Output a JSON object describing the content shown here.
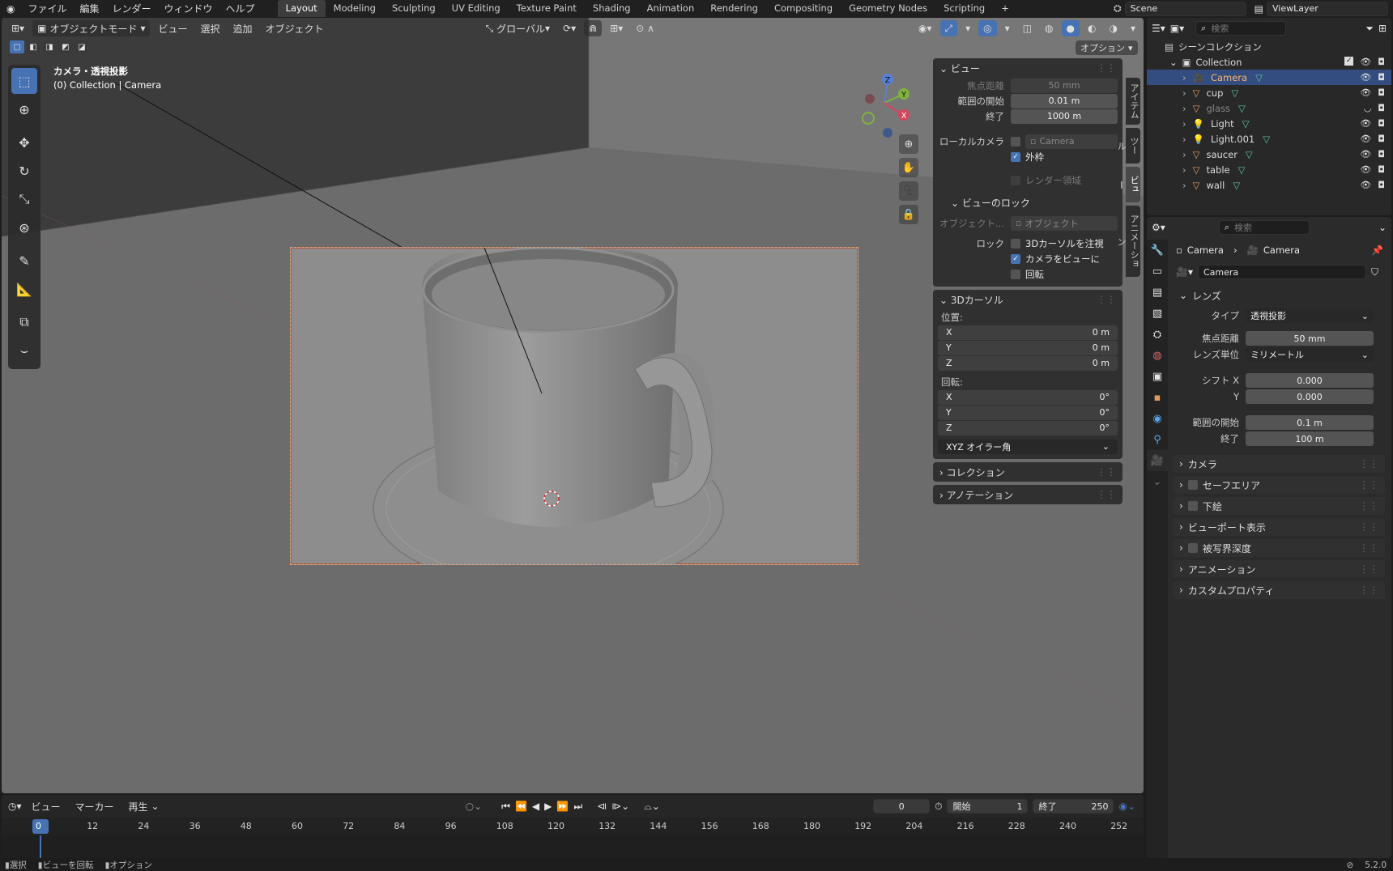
{
  "topbar": {
    "menus": [
      "ファイル",
      "編集",
      "レンダー",
      "ウィンドウ",
      "ヘルプ"
    ],
    "workspaces": [
      "Layout",
      "Modeling",
      "Sculpting",
      "UV Editing",
      "Texture Paint",
      "Shading",
      "Animation",
      "Rendering",
      "Compositing",
      "Geometry Nodes",
      "Scripting"
    ],
    "active_workspace": "Layout",
    "add_tab": "+",
    "scene": "Scene",
    "viewlayer": "ViewLayer"
  },
  "viewport": {
    "mode": "オブジェクトモード",
    "menus": [
      "ビュー",
      "選択",
      "追加",
      "オブジェクト"
    ],
    "transform_orientation": "グローバル",
    "options_button": "オプション",
    "view_title": "カメラ・透視投影",
    "view_subtitle": "(0) Collection | Camera",
    "gizmo": {
      "z": "Z",
      "y": "Y",
      "x": "X"
    }
  },
  "npanel": {
    "tabs": [
      "アイテム",
      "ツール",
      "ビュー",
      "アニメーション"
    ],
    "active_tab": "ビュー",
    "view": {
      "header": "ビュー",
      "focal_label": "焦点距離",
      "focal_value": "50 mm",
      "clip_start_label": "範囲の開始",
      "clip_start_value": "0.01 m",
      "clip_end_label": "終了",
      "clip_end_value": "1000 m",
      "local_camera_label": "ローカルカメラ",
      "local_camera_value": "Camera",
      "outer_frame_label": "外枠",
      "render_region_label": "レンダー領域"
    },
    "view_lock": {
      "header": "ビューのロック",
      "object_label": "オブジェクト...",
      "object_value": "オブジェクト",
      "lock_label": "ロック",
      "lock_cursor": "3Dカーソルを注視",
      "camera_to_view": "カメラをビューに",
      "rotation": "回転"
    },
    "cursor": {
      "header": "3Dカーソル",
      "location_label": "位置:",
      "loc": [
        {
          "axis": "X",
          "value": "0 m"
        },
        {
          "axis": "Y",
          "value": "0 m"
        },
        {
          "axis": "Z",
          "value": "0 m"
        }
      ],
      "rotation_label": "回転:",
      "rot": [
        {
          "axis": "X",
          "value": "0°"
        },
        {
          "axis": "Y",
          "value": "0°"
        },
        {
          "axis": "Z",
          "value": "0°"
        }
      ],
      "rotation_mode": "XYZ オイラー角"
    },
    "collection_header": "コレクション",
    "annotation_header": "アノテーション"
  },
  "timeline": {
    "menus": [
      "ビュー",
      "マーカー",
      "再生"
    ],
    "current_frame": "0",
    "start_label": "開始",
    "start_value": "1",
    "end_label": "終了",
    "end_value": "250",
    "ticks": [
      "0",
      "12",
      "24",
      "36",
      "48",
      "60",
      "72",
      "84",
      "96",
      "108",
      "120",
      "132",
      "144",
      "156",
      "168",
      "180",
      "192",
      "204",
      "216",
      "228",
      "240",
      "252"
    ]
  },
  "statusbar": {
    "items": [
      "選択",
      "ビューを回転",
      "オプション"
    ],
    "version": "5.2.0"
  },
  "outliner": {
    "search_placeholder": "検索",
    "scene_collection": "シーンコレクション",
    "collection": "Collection",
    "items": [
      {
        "name": "Camera",
        "type": "camera",
        "selected": true
      },
      {
        "name": "cup",
        "type": "mesh",
        "selected": false
      },
      {
        "name": "glass",
        "type": "mesh",
        "selected": false
      },
      {
        "name": "Light",
        "type": "light",
        "selected": false
      },
      {
        "name": "Light.001",
        "type": "light",
        "selected": false
      },
      {
        "name": "saucer",
        "type": "mesh",
        "selected": false
      },
      {
        "name": "table",
        "type": "mesh",
        "selected": false
      },
      {
        "name": "wall",
        "type": "mesh",
        "selected": false
      }
    ]
  },
  "properties": {
    "search_placeholder": "検索",
    "breadcrumb_object": "Camera",
    "breadcrumb_data": "Camera",
    "data_name": "Camera",
    "lens": {
      "header": "レンズ",
      "type_label": "タイプ",
      "type_value": "透視投影",
      "focal_label": "焦点距離",
      "focal_value": "50 mm",
      "unit_label": "レンズ単位",
      "unit_value": "ミリメートル",
      "shift_x_label": "シフト X",
      "shift_x_value": "0.000",
      "shift_y_label": "Y",
      "shift_y_value": "0.000",
      "clip_start_label": "範囲の開始",
      "clip_start_value": "0.1 m",
      "clip_end_label": "終了",
      "clip_end_value": "100 m"
    },
    "sections": [
      "カメラ",
      "セーフエリア",
      "下絵",
      "ビューポート表示",
      "被写界深度",
      "アニメーション",
      "カスタムプロパティ"
    ]
  },
  "colors": {
    "accent": "#4772b3",
    "selected_row": "#334d80",
    "camera_icon": "#e39a5b",
    "mesh_icon": "#e39a5b",
    "data_icon": "#5cc39a"
  }
}
